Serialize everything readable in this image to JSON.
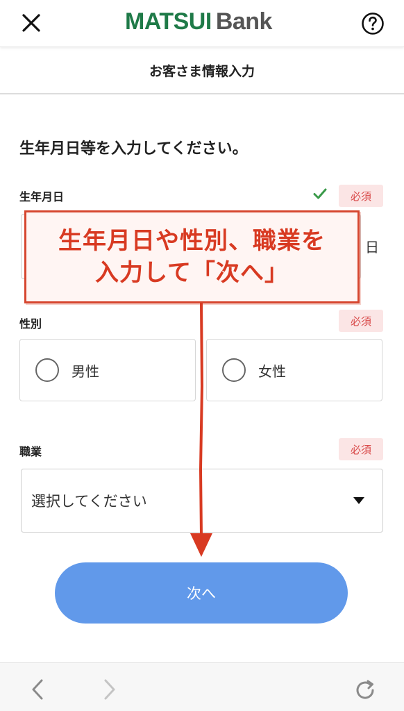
{
  "header": {
    "brand_part1": "MATSUI",
    "brand_part2": "Bank",
    "close_icon": "close-icon",
    "help_icon": "help-icon",
    "brand_color": "#1f7a48"
  },
  "subheader": {
    "title": "お客さま情報入力"
  },
  "form": {
    "title": "生年月日等を入力してください。",
    "required_label": "必須",
    "birthdate": {
      "label": "生年月日",
      "day_suffix": "日",
      "valid": true
    },
    "gender": {
      "label": "性別",
      "options": [
        {
          "label": "男性",
          "selected": false
        },
        {
          "label": "女性",
          "selected": false
        }
      ]
    },
    "occupation": {
      "label": "職業",
      "placeholder": "選択してください"
    },
    "next_button": "次へ",
    "next_button_color": "#6199ea"
  },
  "annotation": {
    "line1": "生年月日や性別、職業を",
    "line2": "入力して「次へ」",
    "color": "#d83a22"
  },
  "bottom_nav": {
    "back_icon": "chevron-left-icon",
    "forward_icon": "chevron-right-icon",
    "reload_icon": "reload-icon"
  }
}
